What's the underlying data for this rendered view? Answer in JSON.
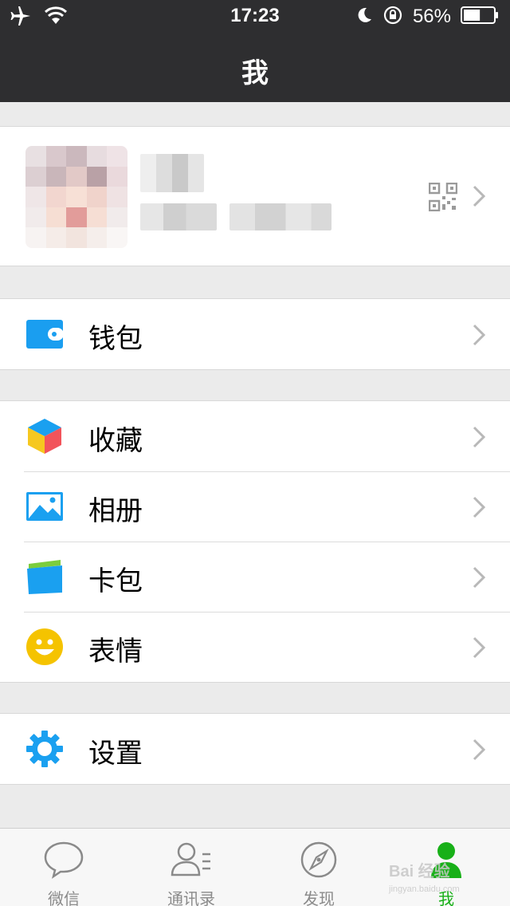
{
  "status_bar": {
    "time": "17:23",
    "battery_pct": "56%",
    "battery_level": 0.56,
    "icons": [
      "airplane-icon",
      "wifi-icon",
      "moon-icon",
      "rotation-lock-icon",
      "battery-icon"
    ]
  },
  "nav": {
    "title": "我"
  },
  "profile": {
    "icons": [
      "avatar",
      "qr-code-icon",
      "chevron-right-icon"
    ]
  },
  "menu": {
    "wallet": {
      "label": "钱包",
      "icon": "wallet-icon"
    },
    "favorites": {
      "label": "收藏",
      "icon": "cube-icon"
    },
    "album": {
      "label": "相册",
      "icon": "picture-icon"
    },
    "cards": {
      "label": "卡包",
      "icon": "card-icon"
    },
    "stickers": {
      "label": "表情",
      "icon": "smiley-icon"
    },
    "settings": {
      "label": "设置",
      "icon": "gear-icon"
    }
  },
  "tabs": [
    {
      "label": "微信",
      "icon": "chat-bubble-icon"
    },
    {
      "label": "通讯录",
      "icon": "contacts-icon"
    },
    {
      "label": "发现",
      "icon": "compass-icon"
    },
    {
      "label": "我",
      "icon": "person-icon",
      "active": true
    }
  ],
  "watermark": {
    "text": "Bai 经验",
    "sub": "jingyan.baidu.com"
  },
  "colors": {
    "nav_bg": "#2e2e30",
    "active_tab": "#18b018",
    "page_bg": "#ebebeb",
    "accent_blue": "#1aa0f0"
  }
}
